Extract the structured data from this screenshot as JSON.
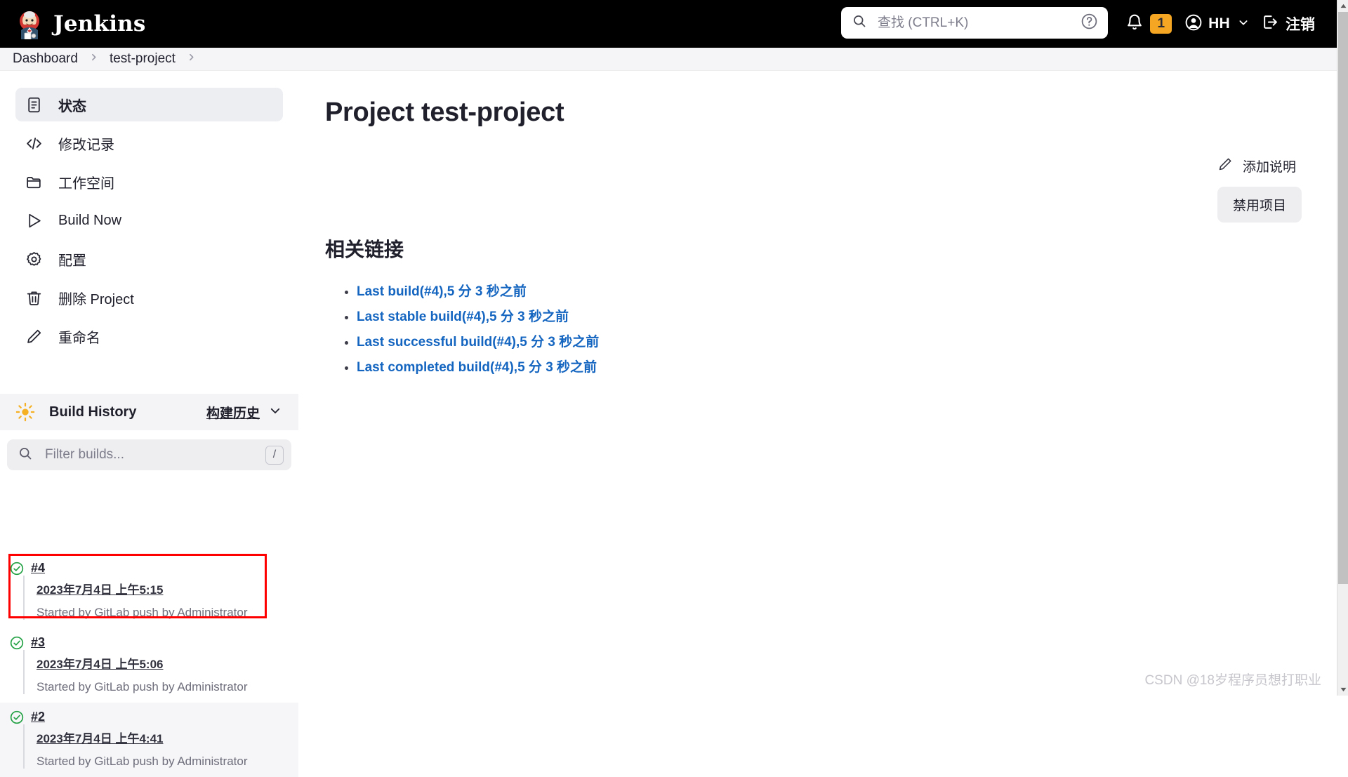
{
  "header": {
    "brand": "Jenkins",
    "brand_logo_icon": "jenkins-butler-logo",
    "search_placeholder": "查找 (CTRL+K)",
    "search_value": "",
    "search_icon": "search-icon",
    "help_icon": "help-circle-icon",
    "bell_icon": "bell-icon",
    "notification_count": "1",
    "user_icon": "user-circle-icon",
    "user_name": "HH",
    "user_chevron_icon": "chevron-down-icon",
    "logout_icon": "logout-icon",
    "logout_label": "注销"
  },
  "breadcrumb": {
    "items": [
      {
        "label": "Dashboard"
      },
      {
        "label": "test-project"
      }
    ],
    "separator_icon": "chevron-right-icon"
  },
  "sidebar": {
    "menu": [
      {
        "label": "状态",
        "icon": "document-status-icon",
        "active": true
      },
      {
        "label": "修改记录",
        "icon": "code-brackets-icon",
        "active": false
      },
      {
        "label": "工作空间",
        "icon": "folder-icon",
        "active": false
      },
      {
        "label": "Build Now",
        "icon": "play-triangle-icon",
        "active": false
      },
      {
        "label": "配置",
        "icon": "gear-icon",
        "active": false
      },
      {
        "label": "删除 Project",
        "icon": "trash-icon",
        "active": false
      },
      {
        "label": "重命名",
        "icon": "pencil-icon",
        "active": false
      }
    ],
    "build_history": {
      "icon": "weather-sun-icon",
      "title": "Build History",
      "link_label": "构建历史",
      "chevron_icon": "chevron-down-icon",
      "filter_placeholder": "Filter builds...",
      "filter_value": "",
      "filter_icon": "search-icon",
      "filter_shortcut": "/",
      "builds": [
        {
          "number": "#4",
          "status_icon": "check-circle-success-icon",
          "timestamp": "2023年7月4日 上午5:15",
          "cause": "Started by GitLab push by Administrator",
          "highlighted": true
        },
        {
          "number": "#3",
          "status_icon": "check-circle-success-icon",
          "timestamp": "2023年7月4日 上午5:06",
          "cause": "Started by GitLab push by Administrator",
          "highlighted": false
        },
        {
          "number": "#2",
          "status_icon": "check-circle-success-icon",
          "timestamp": "2023年7月4日 上午4:41",
          "cause": "Started by GitLab push by Administrator",
          "highlighted": false
        }
      ]
    }
  },
  "main": {
    "page_title": "Project test-project",
    "add_description_label": "添加说明",
    "add_description_icon": "pencil-icon",
    "disable_project_label": "禁用项目",
    "related_links_title": "相关链接",
    "related_links": [
      {
        "label": "Last build(#4),5 分 3 秒之前"
      },
      {
        "label": "Last stable build(#4),5 分 3 秒之前"
      },
      {
        "label": "Last successful build(#4),5 分 3 秒之前"
      },
      {
        "label": "Last completed build(#4),5 分 3 秒之前"
      }
    ]
  },
  "watermark": "CSDN @18岁程序员想打职业",
  "colors": {
    "topbar_bg": "#000000",
    "link_blue": "#1465c0",
    "success_green": "#23a144",
    "badge_orange": "#f5a623",
    "annotation_red": "#ff0000",
    "sun_yellow": "#f5b023"
  }
}
